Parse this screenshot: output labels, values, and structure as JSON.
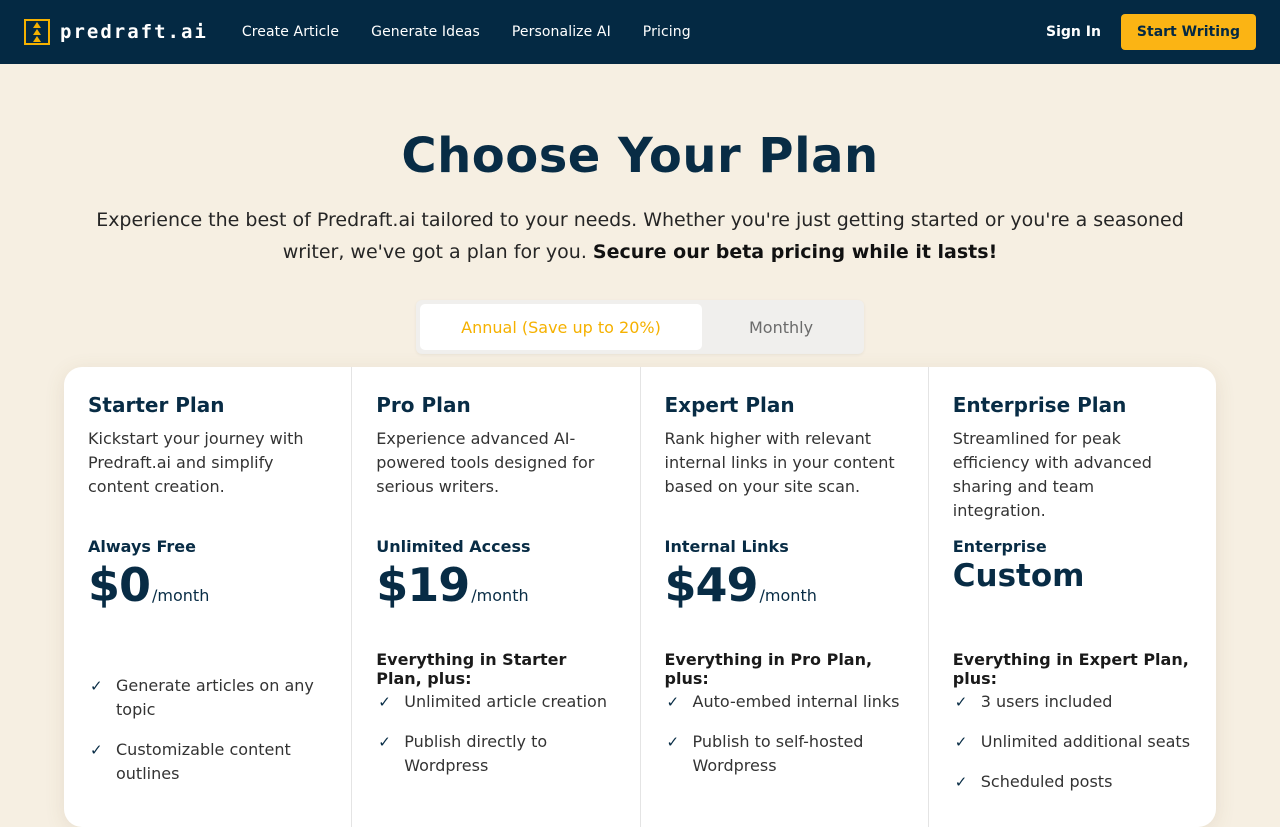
{
  "nav": {
    "logo": "predraft.ai",
    "links": [
      "Create Article",
      "Generate Ideas",
      "Personalize AI",
      "Pricing"
    ],
    "sign_in": "Sign In",
    "cta": "Start Writing"
  },
  "hero": {
    "title": "Choose Your Plan",
    "subtitle": "Experience the best of Predraft.ai tailored to your needs. Whether you're just getting started or you're a seasoned writer, we've got a plan for you.",
    "subtitle_bold": "Secure our beta pricing while it lasts!"
  },
  "billing_toggle": {
    "annual": "Annual (Save up to 20%)",
    "monthly": "Monthly",
    "selected": "annual"
  },
  "plans": [
    {
      "name": "Starter Plan",
      "description": "Kickstart your journey with Predraft.ai and simplify content creation.",
      "tier": "Always Free",
      "price": "$0",
      "period": "/month",
      "includes": "",
      "features": [
        "Generate articles on any topic",
        "Customizable content outlines"
      ]
    },
    {
      "name": "Pro Plan",
      "description": "Experience advanced AI-powered tools designed for serious writers.",
      "tier": "Unlimited Access",
      "price": "$19",
      "period": "/month",
      "includes": "Everything in Starter Plan, plus:",
      "features": [
        "Unlimited article creation",
        "Publish directly to Wordpress"
      ]
    },
    {
      "name": "Expert Plan",
      "description": "Rank higher with relevant internal links in your content based on your site scan.",
      "tier": "Internal Links",
      "price": "$49",
      "period": "/month",
      "includes": "Everything in Pro Plan, plus:",
      "features": [
        "Auto-embed internal links",
        "Publish to self-hosted Wordpress"
      ]
    },
    {
      "name": "Enterprise Plan",
      "description": "Streamlined for peak efficiency with advanced sharing and team integration.",
      "tier": "Enterprise",
      "price": "Custom",
      "period": "",
      "includes": "Everything in Expert Plan, plus:",
      "features": [
        "3 users included",
        "Unlimited additional seats",
        "Scheduled posts"
      ]
    }
  ],
  "colors": {
    "nav_bg": "#042943",
    "accent": "#fbb414",
    "page_bg": "#f6efe2",
    "heading": "#082c45"
  }
}
